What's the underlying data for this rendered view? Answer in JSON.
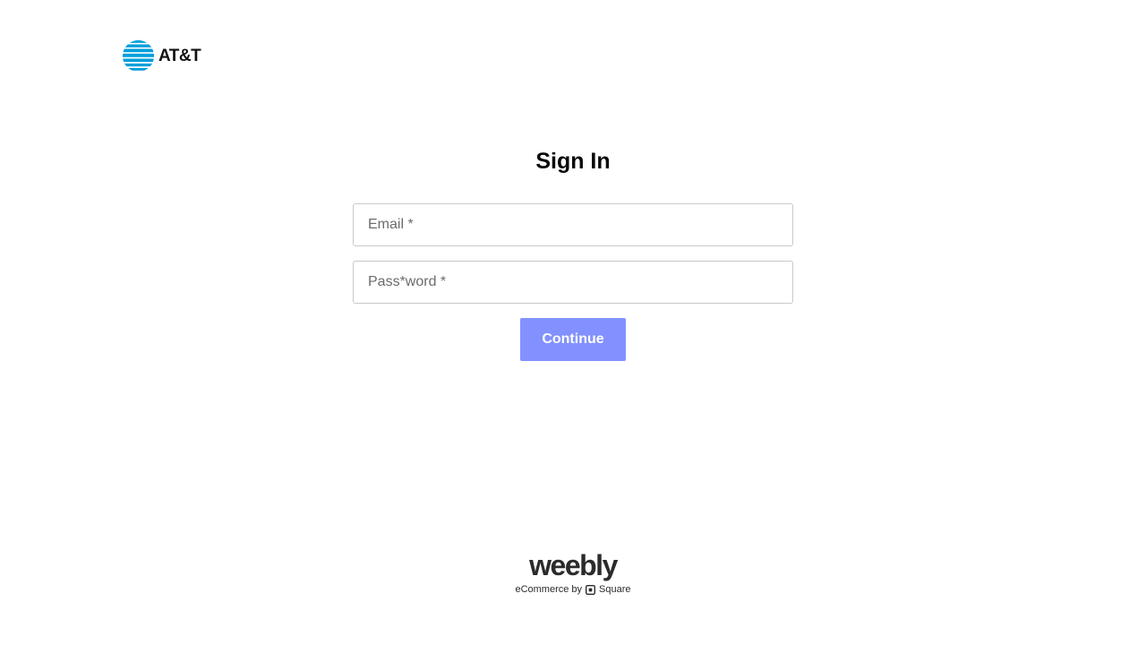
{
  "header": {
    "brand_name": "AT&T",
    "brand_icon": "att-globe-icon",
    "brand_color": "#009fdb"
  },
  "form": {
    "title": "Sign In",
    "email_placeholder": "Email *",
    "password_placeholder": "Pass*word *",
    "email_value": "",
    "password_value": "",
    "continue_label": "Continue",
    "button_color": "#8291ff"
  },
  "footer": {
    "product_name": "weebly",
    "tagline_prefix": "eCommerce by",
    "partner_name": "Square",
    "partner_icon": "square-logo-icon"
  }
}
